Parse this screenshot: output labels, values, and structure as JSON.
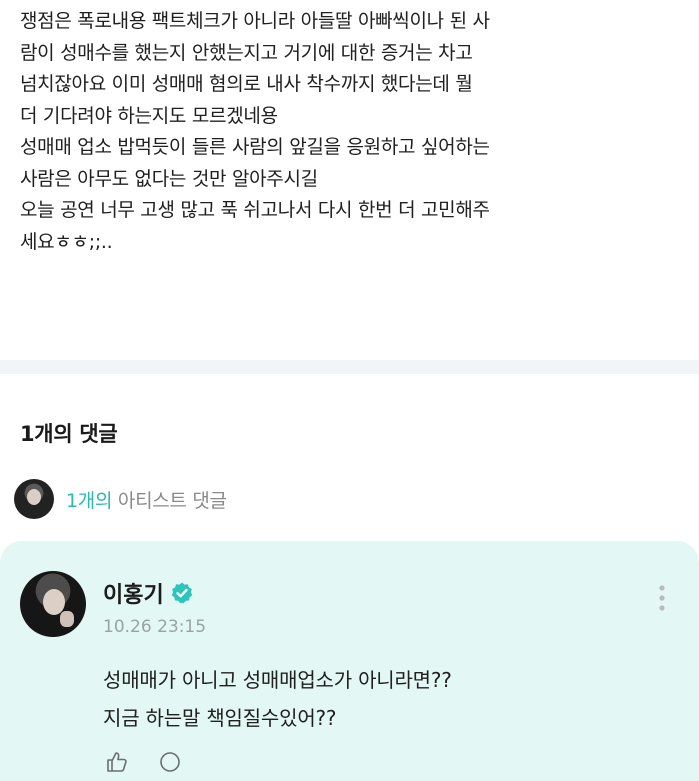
{
  "post": {
    "lines": [
      "쟁점은 폭로내용 팩트체크가 아니라 아들딸 아빠씩이나 된 사",
      "람이 성매수를 했는지 안했는지고 거기에 대한 증거는 차고",
      "넘치잖아요 이미 성매매 혐의로 내사 착수까지 했다는데 뭘",
      "더 기다려야 하는지도 모르겠네용",
      "성매매 업소 밥먹듯이 들른 사람의 앞길을 응원하고 싶어하는",
      "사람은 아무도 없다는 것만 알아주시길",
      "오늘 공연 너무 고생 많고 푹 쉬고나서 다시 한번 더 고민해주",
      "세요ㅎㅎ;;.."
    ]
  },
  "comments": {
    "title": "1개의 댓글",
    "artist_count": "1개의",
    "artist_label": " 아티스트 댓글"
  },
  "comment": {
    "author": "이홍기",
    "time": "10.26 23:15",
    "lines": [
      "성매매가 아니고 성매매업소가 아니라면??",
      "지금 하는말 책임질수있어??"
    ]
  },
  "colors": {
    "accent": "#2ab8b0",
    "card_bg": "#e3f7f4",
    "verified": "#2ec4bb"
  },
  "icons": {
    "verified": "verified-badge-icon",
    "more": "more-vertical-icon",
    "like": "like-icon",
    "reply": "reply-icon"
  }
}
